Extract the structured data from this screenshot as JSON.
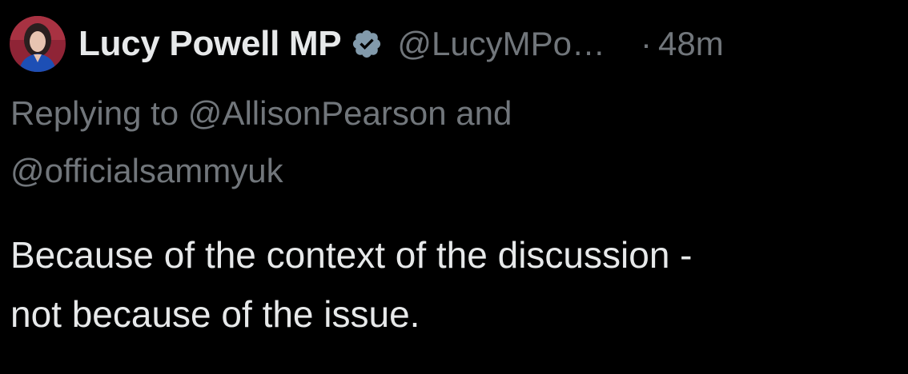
{
  "tweet": {
    "author": {
      "display_name": "Lucy Powell MP",
      "handle": "@LucyMPo…",
      "verified_icon": "verified-badge-icon",
      "avatar_icon": "profile-photo"
    },
    "separator": "·",
    "timestamp": "48m",
    "replying": {
      "prefix": "Replying to",
      "mention_1": "@AllisonPearson",
      "conjunction": "and",
      "mention_2": "@officialsammyuk"
    },
    "text_line_1": "Because of the context of the discussion -",
    "text_line_2": "not because of the issue."
  },
  "colors": {
    "background": "#000000",
    "primary_text": "#e7e9ea",
    "secondary_text": "#71767b",
    "verified_badge": "#829aab"
  }
}
